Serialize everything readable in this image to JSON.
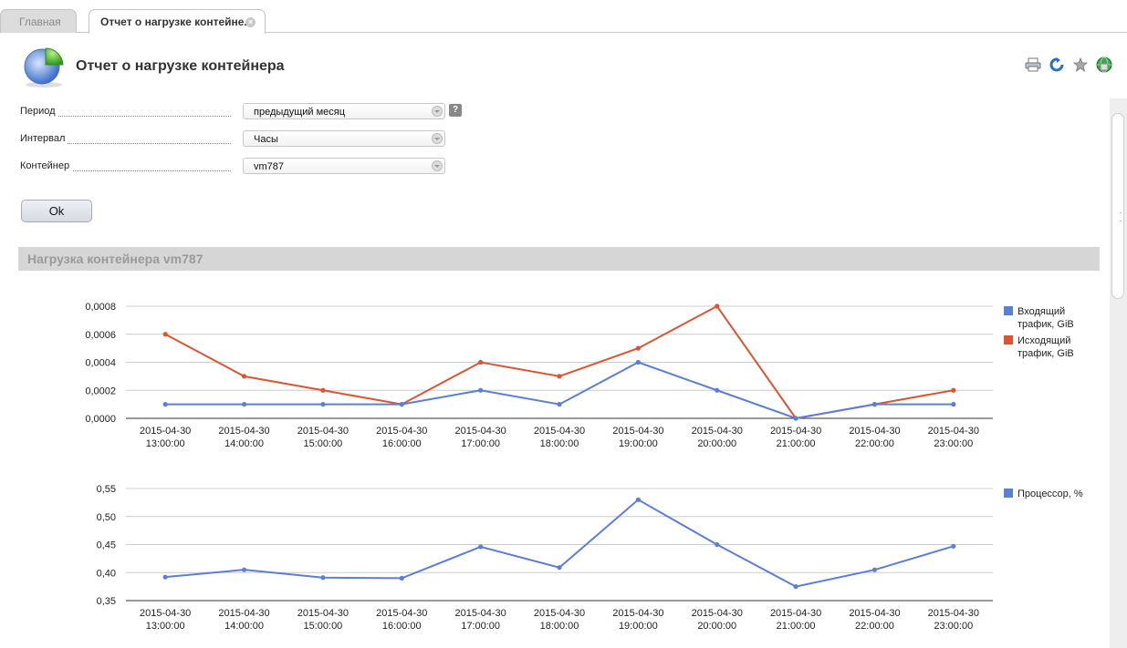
{
  "tabs": [
    {
      "label": "Главная"
    },
    {
      "label": "Отчет о нагрузке контейне..."
    }
  ],
  "page": {
    "title": "Отчет о нагрузке контейнера",
    "icon": "pie-chart-icon"
  },
  "toolbar": {
    "icons": [
      "print-icon",
      "refresh-icon",
      "star-icon",
      "globe-icon"
    ]
  },
  "form": {
    "period": {
      "label": "Период",
      "value": "предыдущий месяц",
      "help": "?"
    },
    "interval": {
      "label": "Интервал",
      "value": "Часы"
    },
    "container": {
      "label": "Контейнер",
      "value": "vm787"
    },
    "ok_label": "Ok"
  },
  "section": {
    "title": "Нагрузка контейнера vm787"
  },
  "colors": {
    "blue": "#5b7fd4",
    "orange": "#dc5533"
  },
  "chart_data": [
    {
      "type": "line",
      "categories": [
        "2015-04-30 13:00:00",
        "2015-04-30 14:00:00",
        "2015-04-30 15:00:00",
        "2015-04-30 16:00:00",
        "2015-04-30 17:00:00",
        "2015-04-30 18:00:00",
        "2015-04-30 19:00:00",
        "2015-04-30 20:00:00",
        "2015-04-30 21:00:00",
        "2015-04-30 22:00:00",
        "2015-04-30 23:00:00"
      ],
      "yticks": [
        "0,0000",
        "0,0002",
        "0,0004",
        "0,0006",
        "0,0008"
      ],
      "ylim": [
        0,
        0.0008
      ],
      "series": [
        {
          "name": "Входящий трафик, GiB",
          "color": "#5b7fd4",
          "values": [
            0.0001,
            0.0001,
            0.0001,
            0.0001,
            0.0002,
            0.0001,
            0.0004,
            0.0002,
            0.0,
            0.0001,
            0.0001
          ]
        },
        {
          "name": "Исходящий трафик, GiB",
          "color": "#dc5533",
          "values": [
            0.0006,
            0.0003,
            0.0002,
            0.0001,
            0.0004,
            0.0003,
            0.0005,
            0.0008,
            0.0,
            0.0001,
            0.0002
          ]
        }
      ],
      "legend_position": "right"
    },
    {
      "type": "line",
      "categories": [
        "2015-04-30 13:00:00",
        "2015-04-30 14:00:00",
        "2015-04-30 15:00:00",
        "2015-04-30 16:00:00",
        "2015-04-30 17:00:00",
        "2015-04-30 18:00:00",
        "2015-04-30 19:00:00",
        "2015-04-30 20:00:00",
        "2015-04-30 21:00:00",
        "2015-04-30 22:00:00",
        "2015-04-30 23:00:00"
      ],
      "yticks": [
        "0,35",
        "0,40",
        "0,45",
        "0,50",
        "0,55"
      ],
      "ylim": [
        0.35,
        0.55
      ],
      "series": [
        {
          "name": "Процессор, %",
          "color": "#5b7fd4",
          "values": [
            0.392,
            0.405,
            0.391,
            0.39,
            0.446,
            0.409,
            0.53,
            0.45,
            0.375,
            0.405,
            0.447
          ]
        }
      ],
      "legend_position": "right"
    }
  ]
}
